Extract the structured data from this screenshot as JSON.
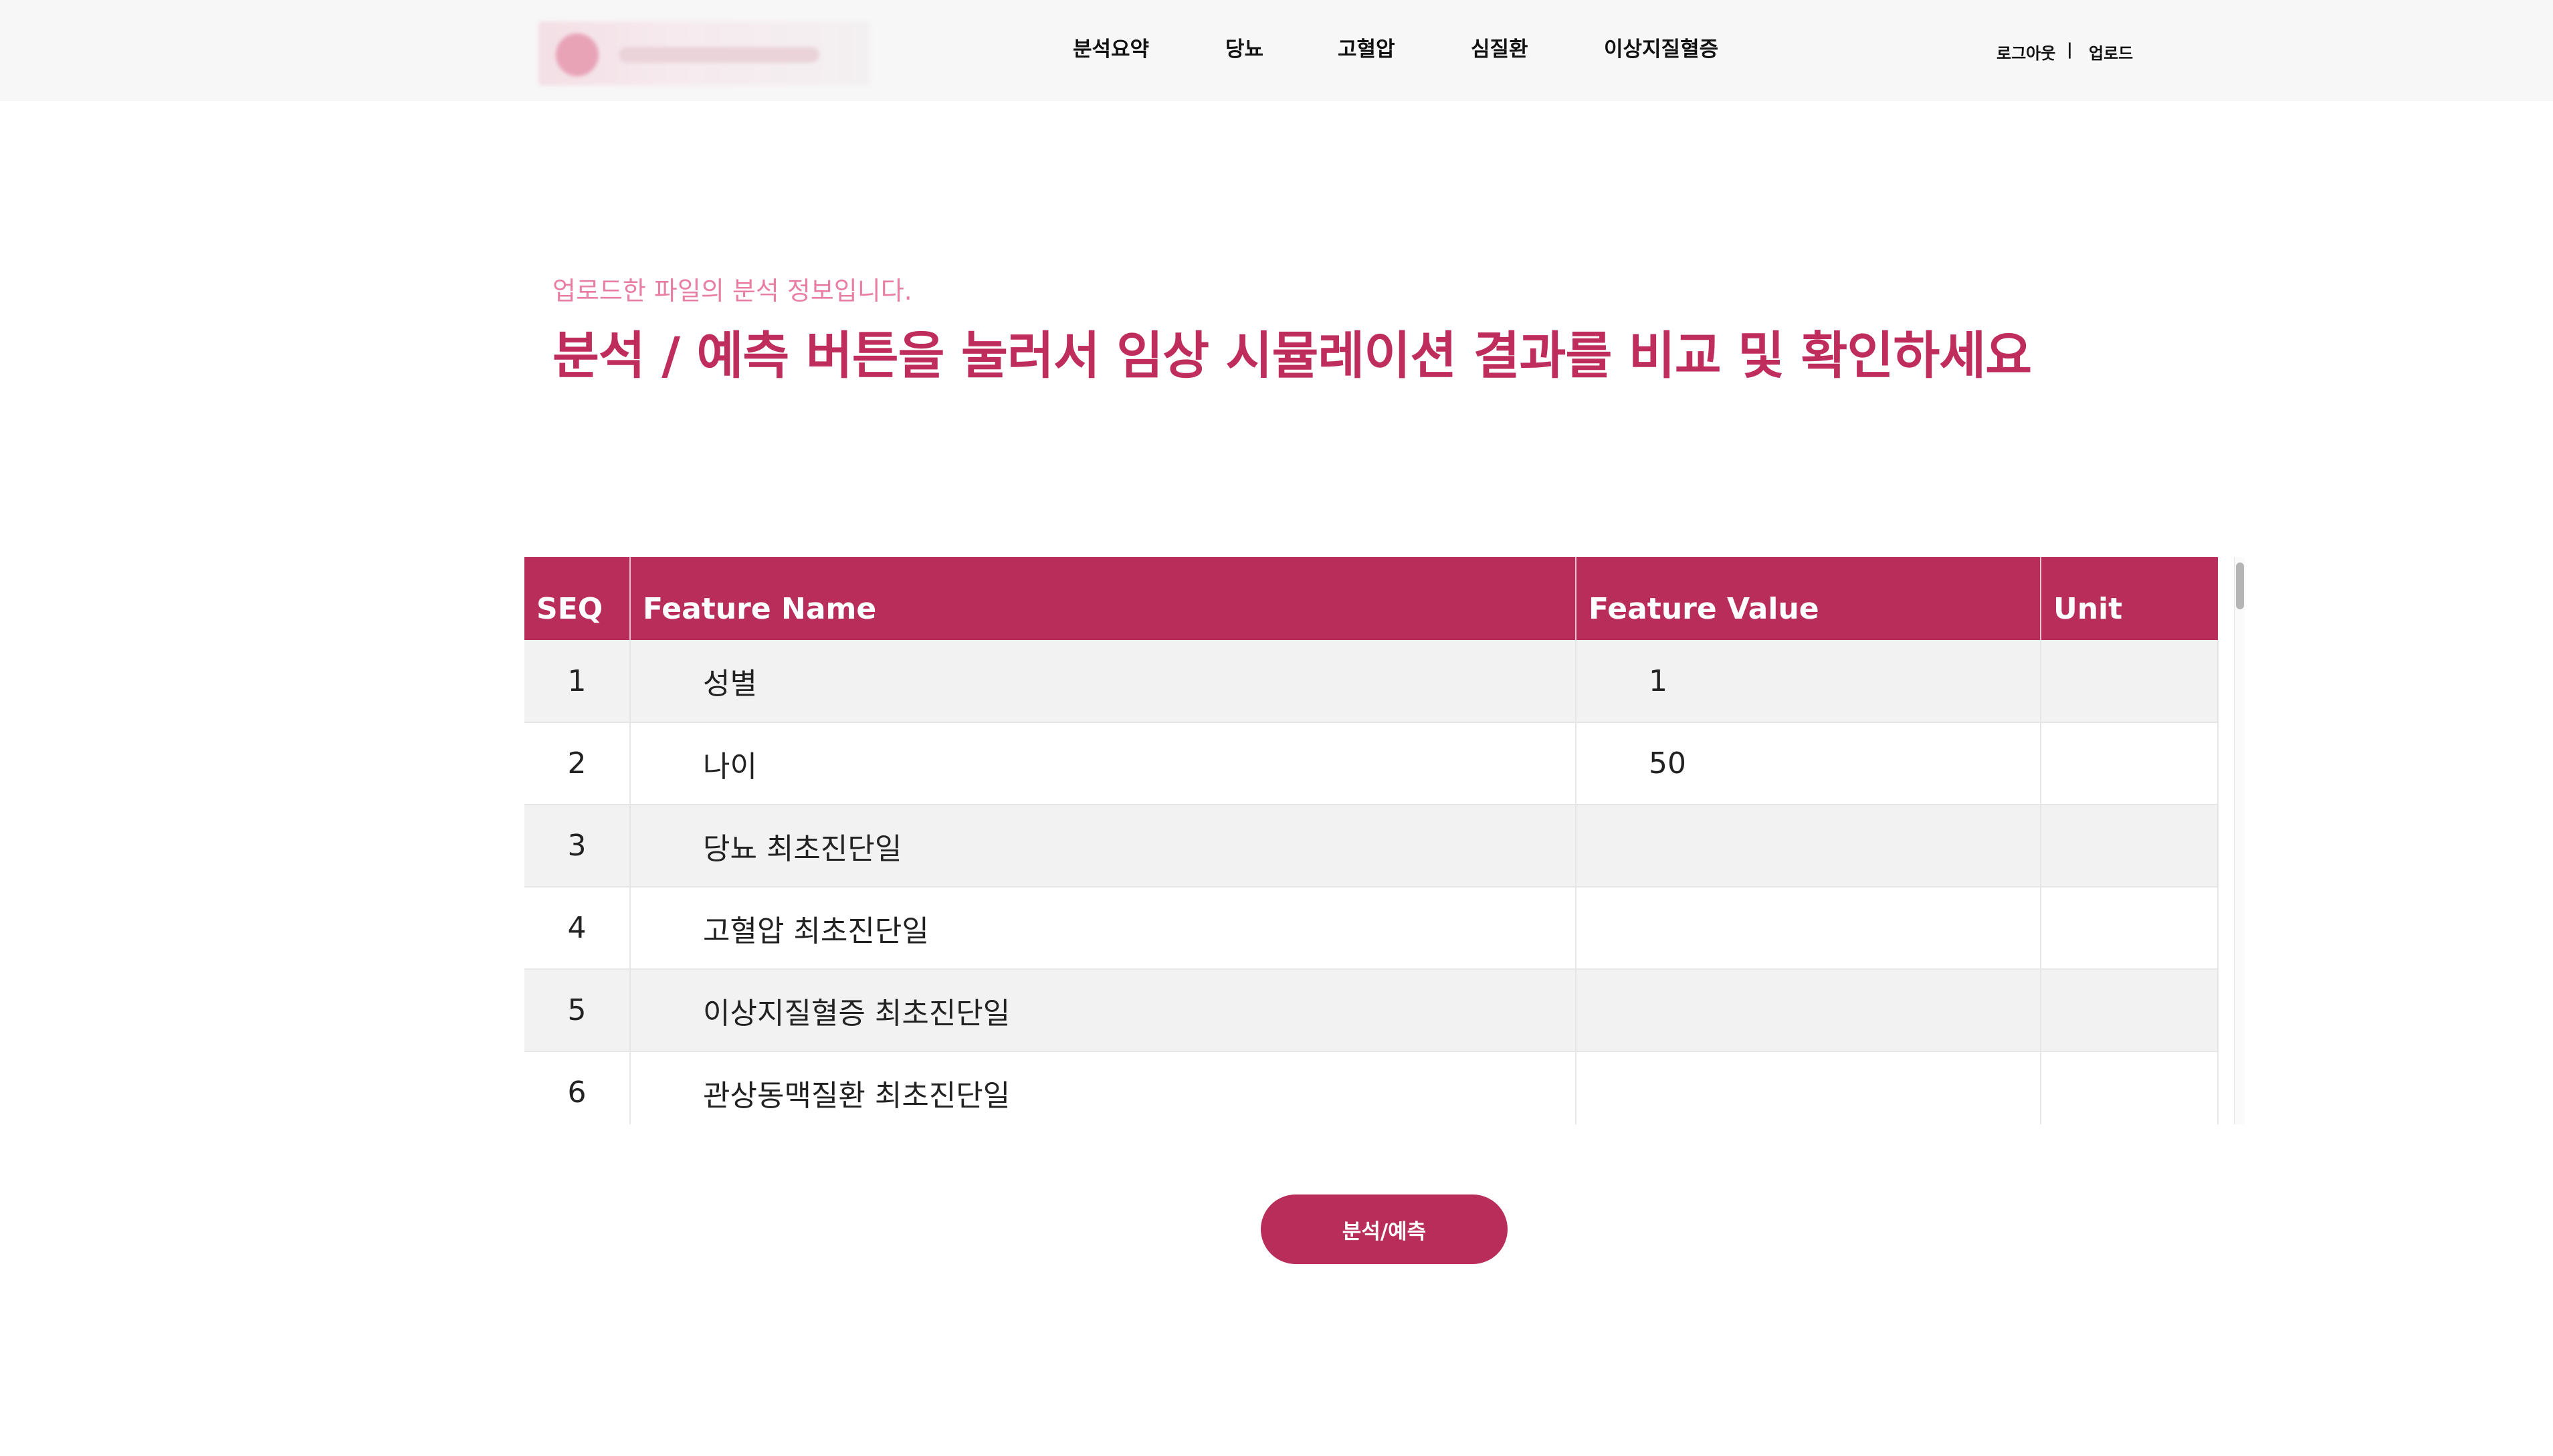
{
  "nav": {
    "items": [
      {
        "label": "분석요약"
      },
      {
        "label": "당뇨"
      },
      {
        "label": "고혈압"
      },
      {
        "label": "심질환"
      },
      {
        "label": "이상지질혈증"
      }
    ],
    "logout": "로그아웃",
    "separator": "|",
    "upload": "업로드"
  },
  "header": {
    "subtitle": "업로드한 파일의 분석 정보입니다.",
    "title": "분석 / 예측 버튼을 눌러서 임상 시뮬레이션 결과를 비교 및 확인하세요"
  },
  "table": {
    "columns": [
      "SEQ",
      "Feature Name",
      "Feature Value",
      "Unit"
    ],
    "rows": [
      {
        "seq": "1",
        "name": "성별",
        "value": "1",
        "unit": ""
      },
      {
        "seq": "2",
        "name": "나이",
        "value": "50",
        "unit": ""
      },
      {
        "seq": "3",
        "name": "당뇨 최초진단일",
        "value": "",
        "unit": ""
      },
      {
        "seq": "4",
        "name": "고혈압 최초진단일",
        "value": "",
        "unit": ""
      },
      {
        "seq": "5",
        "name": "이상지질혈증 최초진단일",
        "value": "",
        "unit": ""
      },
      {
        "seq": "6",
        "name": "관상동맥질환 최초진단일",
        "value": "",
        "unit": ""
      }
    ]
  },
  "actions": {
    "predict_label": "분석/예측"
  },
  "colors": {
    "accent": "#b82d5a",
    "title": "#bf2d5c",
    "subtitle": "#e87ea1"
  }
}
